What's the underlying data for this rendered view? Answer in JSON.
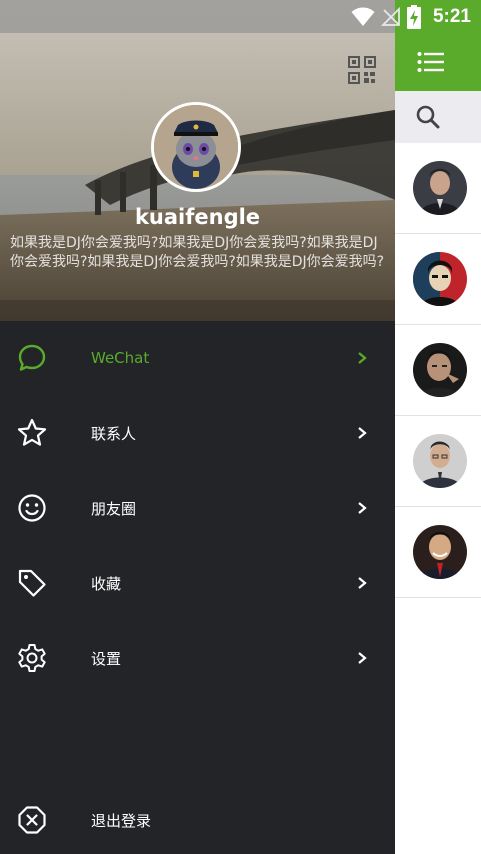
{
  "status_bar": {
    "time": "5:21"
  },
  "drawer": {
    "header": {
      "username": "kuaifengle",
      "signature": "如果我是DJ你会爱我吗?如果我是DJ你会爱我吗?如果我是DJ你会爱我吗?如果我是DJ你会爱我吗?如果我是DJ你会爱我吗?"
    },
    "menu": [
      {
        "label": "WeChat",
        "icon": "chat-bubble-icon",
        "active": true
      },
      {
        "label": "联系人",
        "icon": "star-icon",
        "active": false
      },
      {
        "label": "朋友圈",
        "icon": "smiley-icon",
        "active": false
      },
      {
        "label": "收藏",
        "icon": "tag-icon",
        "active": false
      },
      {
        "label": "设置",
        "icon": "gear-icon",
        "active": false
      }
    ],
    "logout_label": "退出登录"
  },
  "main": {
    "toolbar_icon": "menu-list-icon",
    "search_icon": "search-icon",
    "contacts_count_visible": 5
  },
  "colors": {
    "accent": "#5aab2c",
    "drawer_bg": "#232427",
    "search_bg": "#ececf0"
  }
}
